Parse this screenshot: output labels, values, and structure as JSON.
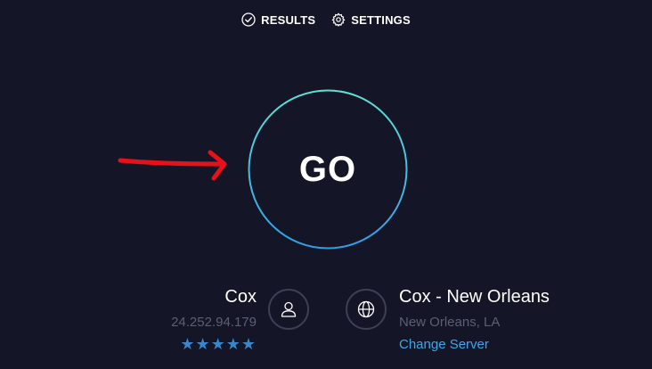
{
  "nav": {
    "results_label": "RESULTS",
    "settings_label": "SETTINGS"
  },
  "go_button": {
    "label": "GO"
  },
  "isp": {
    "name": "Cox",
    "ip": "24.252.94.179",
    "rating_stars": "★★★★★",
    "rating": 5
  },
  "server": {
    "name": "Cox - New Orleans",
    "location": "New Orleans, LA",
    "change_label": "Change Server"
  },
  "colors": {
    "background": "#141526",
    "ring_gradient_top": "#5fe0d4",
    "ring_gradient_bottom": "#2f9ee8",
    "star": "#3a86c8",
    "link": "#37a8f0",
    "annotation_arrow": "#e8101a"
  },
  "icons": {
    "results": "check-circle-icon",
    "settings": "gear-icon",
    "user": "user-icon",
    "globe": "globe-icon"
  }
}
